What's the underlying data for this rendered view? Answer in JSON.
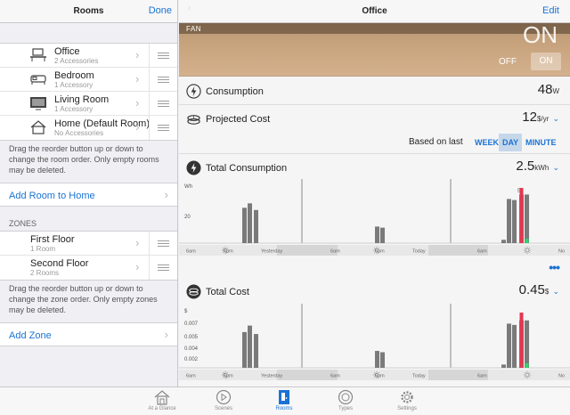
{
  "left": {
    "title": "Rooms",
    "done": "Done",
    "rooms": [
      {
        "name": "Office",
        "sub": "2 Accessories",
        "icon": "desk-icon"
      },
      {
        "name": "Bedroom",
        "sub": "1 Accessory",
        "icon": "bed-icon"
      },
      {
        "name": "Living Room",
        "sub": "1 Accessory",
        "icon": "tv-icon"
      },
      {
        "name": "Home (Default Room)",
        "sub": "No Accessories",
        "icon": "house-icon"
      }
    ],
    "rooms_note": "Drag the reorder button up or down to change the room order. Only empty rooms may be deleted.",
    "add_room": "Add Room to Home",
    "zones_header": "ZONES",
    "zones": [
      {
        "name": "First Floor",
        "sub": "1 Room"
      },
      {
        "name": "Second Floor",
        "sub": "2 Rooms"
      }
    ],
    "zones_note": "Drag the reorder button up or down to change the zone order. Only empty zones may be deleted.",
    "add_zone": "Add Zone"
  },
  "right": {
    "title": "Office",
    "edit": "Edit",
    "fan": {
      "label": "FAN",
      "state_big": "ON",
      "off": "OFF",
      "on": "ON"
    },
    "consumption": {
      "label": "Consumption",
      "value": "48",
      "unit": "W"
    },
    "projected": {
      "label": "Projected Cost",
      "value": "12",
      "unit": "$/yr"
    },
    "based_on": {
      "label": "Based on last",
      "week": "WEEK",
      "day": "DAY",
      "minute": "MINUTE",
      "selected": "DAY"
    },
    "total_consumption": {
      "label": "Total Consumption",
      "value": "2.5",
      "unit": "kWh"
    },
    "total_cost": {
      "label": "Total Cost",
      "value": "0.45",
      "unit": "$"
    }
  },
  "chart_data": [
    {
      "type": "bar",
      "title": "Total Consumption",
      "ylabel": "Wh",
      "yticks": [
        "50",
        "20",
        "7.5"
      ],
      "axis_labels": [
        "6am",
        "6pm",
        "Yesterday",
        "6am",
        "6pm",
        "Today",
        "6am",
        "No"
      ],
      "series": [
        {
          "values": [
            32,
            36,
            30,
            0,
            0,
            0,
            15,
            14,
            0,
            3,
            40,
            39,
            44,
            44
          ]
        },
        {
          "values": [
            0,
            0,
            0,
            0,
            0,
            0,
            0,
            0,
            0,
            0,
            0,
            0,
            50,
            4
          ]
        }
      ]
    },
    {
      "type": "bar",
      "title": "Total Cost",
      "ylabel": "$",
      "yticks": [
        "0.007",
        "0.005",
        "0.004",
        "0.002"
      ],
      "axis_labels": [
        "6am",
        "6pm",
        "Yesterday",
        "6am",
        "6pm",
        "Today",
        "6am",
        "No"
      ],
      "series": [
        {
          "values": [
            0.0055,
            0.0065,
            0.0052,
            0,
            0,
            0,
            0.0026,
            0.0024,
            0,
            0.0005,
            0.0068,
            0.0066,
            0.0073,
            0.0073
          ]
        },
        {
          "values": [
            0,
            0,
            0,
            0,
            0,
            0,
            0,
            0,
            0,
            0,
            0,
            0,
            0.0085,
            0.0007
          ]
        }
      ]
    }
  ],
  "tabbar": [
    {
      "label": "At a Glance",
      "icon": "house-icon"
    },
    {
      "label": "Scenes",
      "icon": "play-icon"
    },
    {
      "label": "Rooms",
      "icon": "door-icon"
    },
    {
      "label": "Types",
      "icon": "types-icon"
    },
    {
      "label": "Settings",
      "icon": "gear-icon"
    }
  ],
  "colors": {
    "accent": "#1a73d4",
    "bar_gray": "#7a7a7a",
    "bar_red": "#e63650",
    "bar_green": "#2fd46b"
  }
}
